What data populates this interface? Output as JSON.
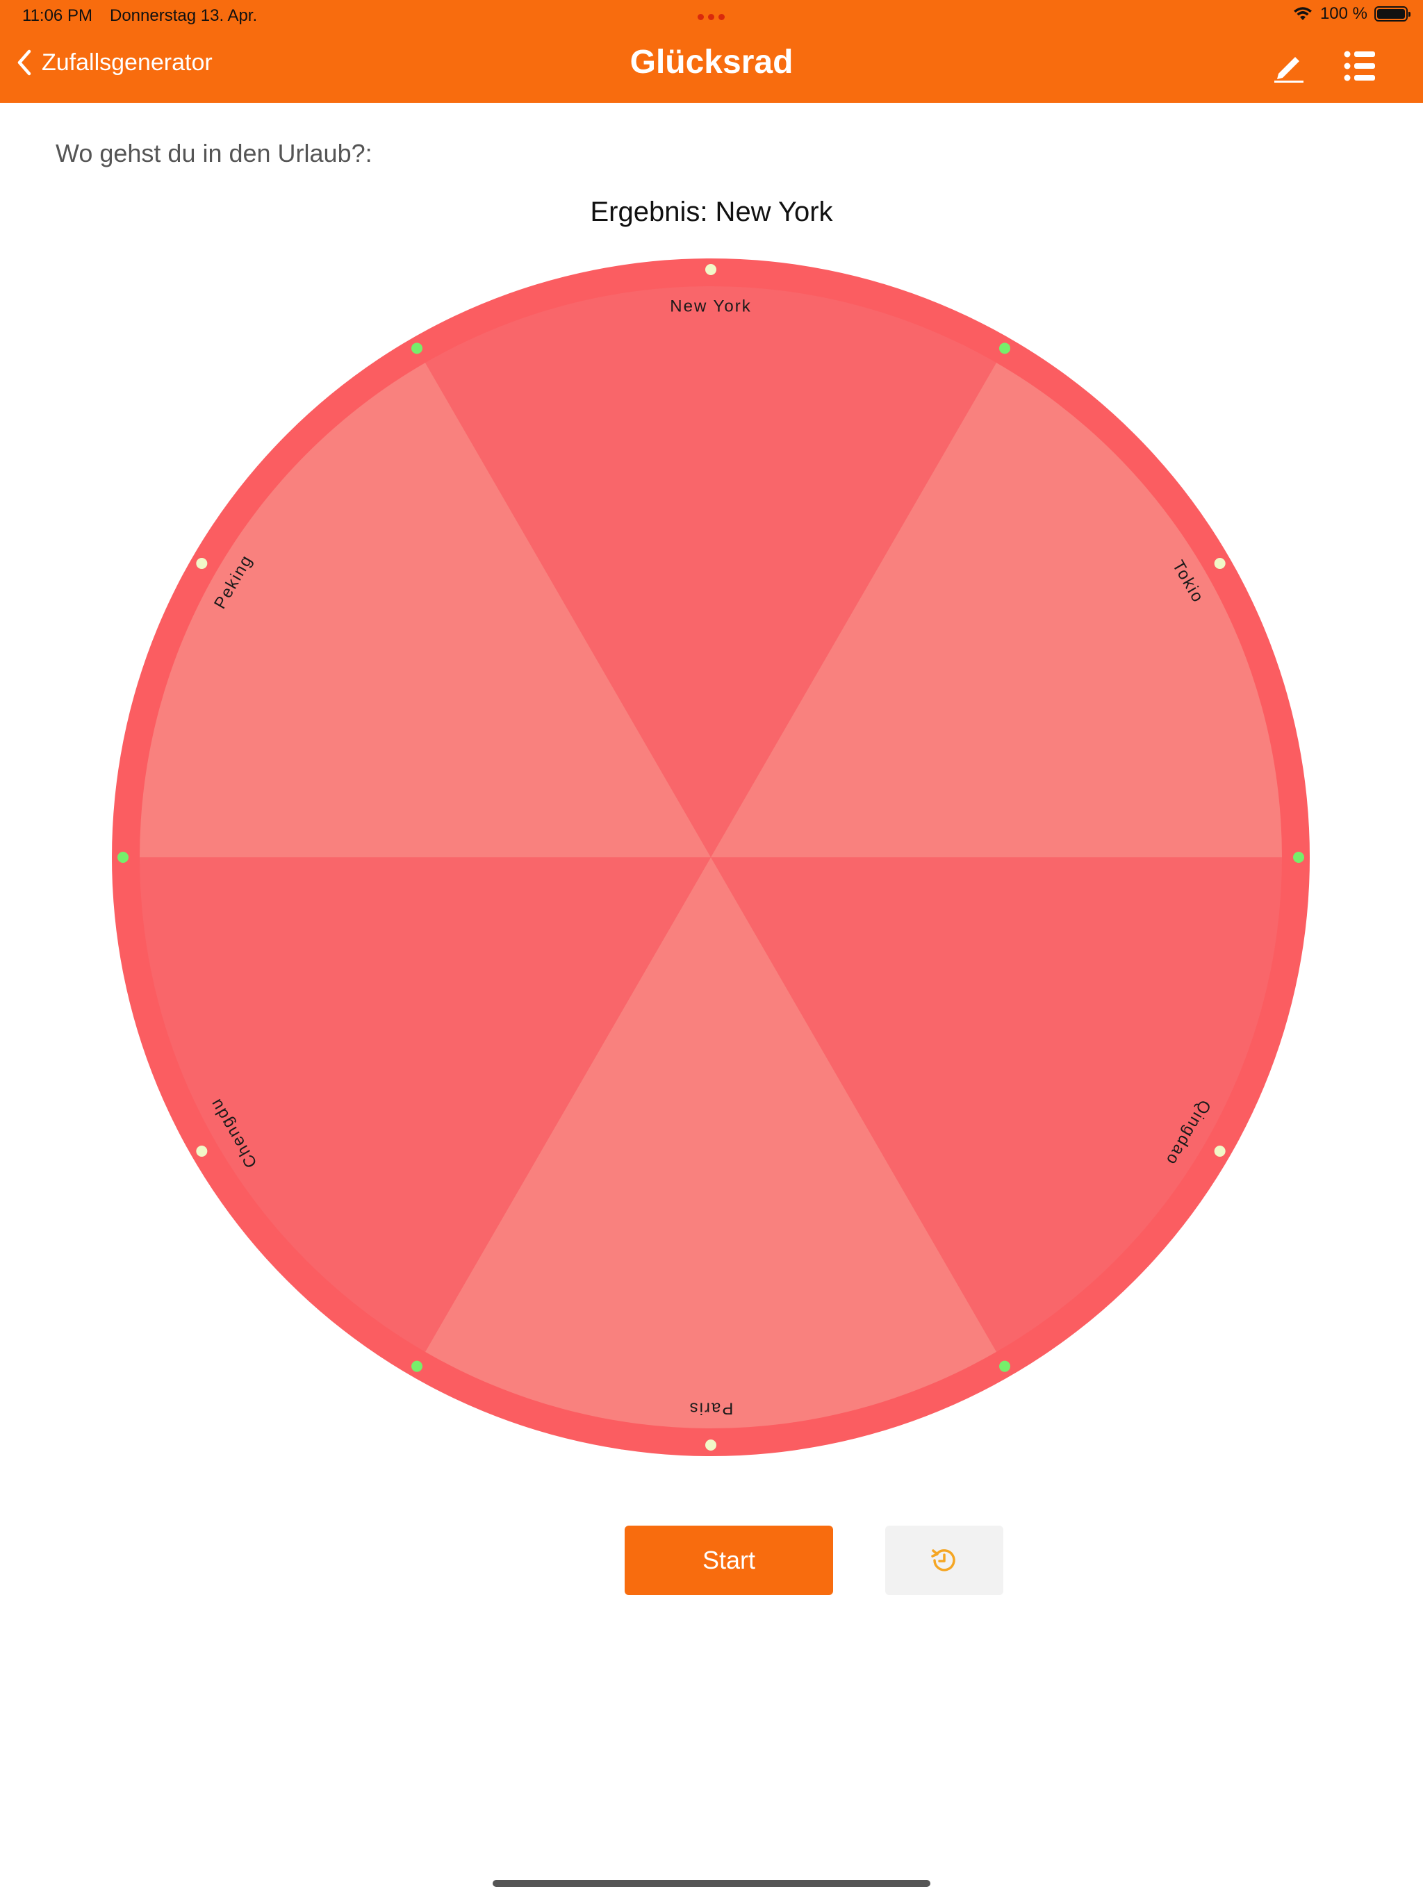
{
  "status_bar": {
    "time": "11:06 PM",
    "date": "Donnerstag 13. Apr.",
    "battery": "100 %"
  },
  "nav": {
    "back_label": "Zufallsgenerator",
    "title": "Glücksrad",
    "edit_icon": "pencil-icon",
    "list_icon": "list-icon"
  },
  "question": "Wo gehst du in den Urlaub?:",
  "result": "Ergebnis: New York",
  "wheel": {
    "segments": [
      {
        "label": "New York",
        "color": "#F9666A"
      },
      {
        "label": "Tokio",
        "color": "#F9817E"
      },
      {
        "label": "Qingdao",
        "color": "#F9666A"
      },
      {
        "label": "Paris",
        "color": "#F9817E"
      },
      {
        "label": "Chengdu",
        "color": "#F9666A"
      },
      {
        "label": "Peking",
        "color": "#F9817E"
      }
    ],
    "rim_color": "#FB5D61",
    "dot_colors": {
      "label_dot": "#F1F8C8",
      "divider_dot": "#76EE6B"
    }
  },
  "buttons": {
    "start_label": "Start",
    "reset_icon": "history-icon"
  },
  "colors": {
    "accent": "#F86C0E"
  }
}
